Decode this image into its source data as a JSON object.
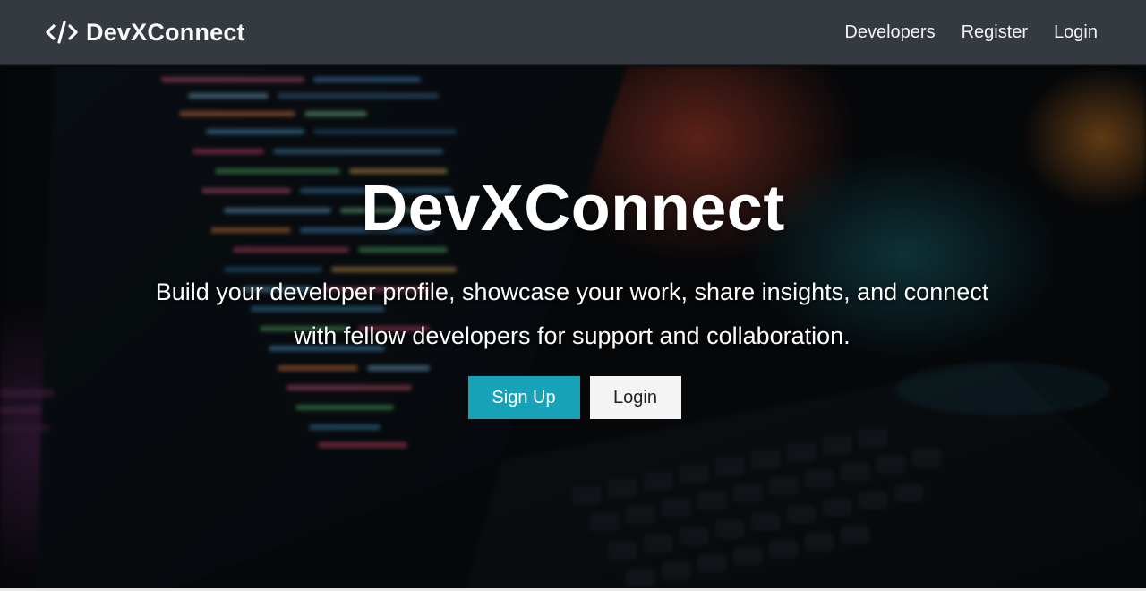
{
  "navbar": {
    "brand_name": "DevXConnect",
    "brand_icon": "code-icon",
    "links": [
      {
        "label": "Developers"
      },
      {
        "label": "Register"
      },
      {
        "label": "Login"
      }
    ]
  },
  "hero": {
    "title": "DevXConnect",
    "lead": "Build your developer profile, showcase your work, share insights, and connect with fellow developers for support and collaboration.",
    "primary_button": "Sign Up",
    "secondary_button": "Login",
    "background": "blurred photo of code on a laptop screen and keyboard"
  },
  "colors": {
    "navbar": "#343a40",
    "accent": "#17a2b8",
    "light_button": "#f4f4f4"
  }
}
